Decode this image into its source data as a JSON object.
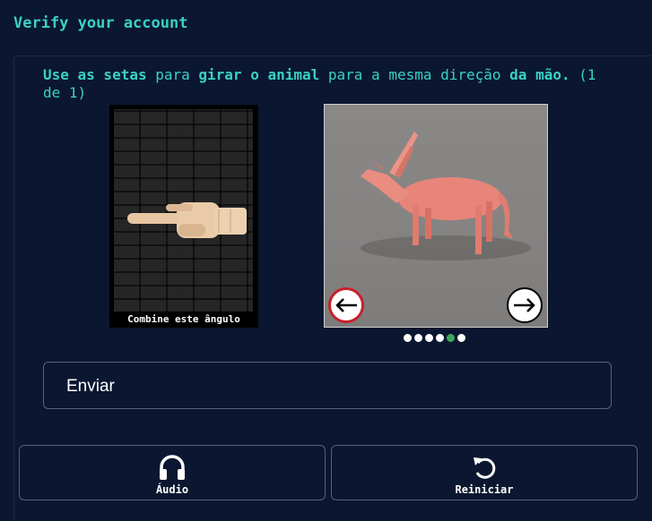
{
  "header": {
    "title": "Verify your account"
  },
  "instruction": {
    "part1": "Use as setas",
    "part2": " para ",
    "part3": "girar o animal",
    "part4": " para a mesma direção ",
    "part5": "da mão.",
    "part6": " (1 de 1)"
  },
  "reference": {
    "caption": "Combine este ângulo",
    "image": "wooden-hand-pointing-left"
  },
  "rotator": {
    "image": "pink-antelope-figure",
    "left_icon": "arrow-left-icon",
    "right_icon": "arrow-right-icon",
    "dots_total": 6,
    "dots_active": 5
  },
  "submit": {
    "label": "Enviar"
  },
  "footer": {
    "audio_label": "Áudio",
    "audio_icon": "headphones-icon",
    "reset_label": "Reiniciar",
    "reset_icon": "restart-icon"
  },
  "colors": {
    "accent": "#3ad1c5",
    "background": "#0b1730",
    "dot_active": "#3aa85a",
    "left_ring": "#c8202a"
  }
}
